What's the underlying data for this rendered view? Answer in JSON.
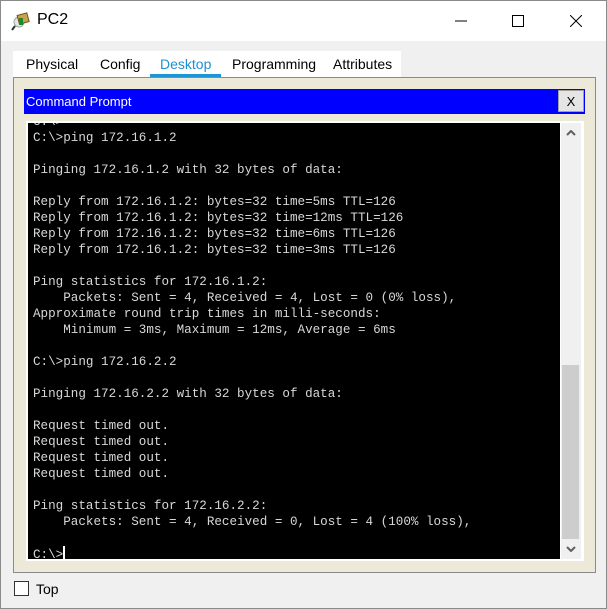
{
  "window": {
    "title": "PC2",
    "icon": "packet-tracer-pc-icon",
    "controls": {
      "minimize": "minimize-icon",
      "maximize": "maximize-icon",
      "close": "close-icon"
    }
  },
  "tabs": [
    {
      "label": "Physical",
      "active": false
    },
    {
      "label": "Config",
      "active": false
    },
    {
      "label": "Desktop",
      "active": true
    },
    {
      "label": "Programming",
      "active": false
    },
    {
      "label": "Attributes",
      "active": false
    }
  ],
  "command_prompt": {
    "title": "Command Prompt",
    "close_label": "X",
    "lines": [
      "C:\\>",
      "C:\\>ping 172.16.1.2",
      "",
      "Pinging 172.16.1.2 with 32 bytes of data:",
      "",
      "Reply from 172.16.1.2: bytes=32 time=5ms TTL=126",
      "Reply from 172.16.1.2: bytes=32 time=12ms TTL=126",
      "Reply from 172.16.1.2: bytes=32 time=6ms TTL=126",
      "Reply from 172.16.1.2: bytes=32 time=3ms TTL=126",
      "",
      "Ping statistics for 172.16.1.2:",
      "    Packets: Sent = 4, Received = 4, Lost = 0 (0% loss),",
      "Approximate round trip times in milli-seconds:",
      "    Minimum = 3ms, Maximum = 12ms, Average = 6ms",
      "",
      "C:\\>ping 172.16.2.2",
      "",
      "Pinging 172.16.2.2 with 32 bytes of data:",
      "",
      "Request timed out.",
      "Request timed out.",
      "Request timed out.",
      "Request timed out.",
      "",
      "Ping statistics for 172.16.2.2:",
      "    Packets: Sent = 4, Received = 0, Lost = 4 (100% loss),",
      ""
    ],
    "prompt": "C:\\>",
    "scroll": {
      "position_fraction": 1.0,
      "visible_fraction": 0.44
    }
  },
  "footer": {
    "top_checkbox_label": "Top",
    "top_checked": false
  }
}
